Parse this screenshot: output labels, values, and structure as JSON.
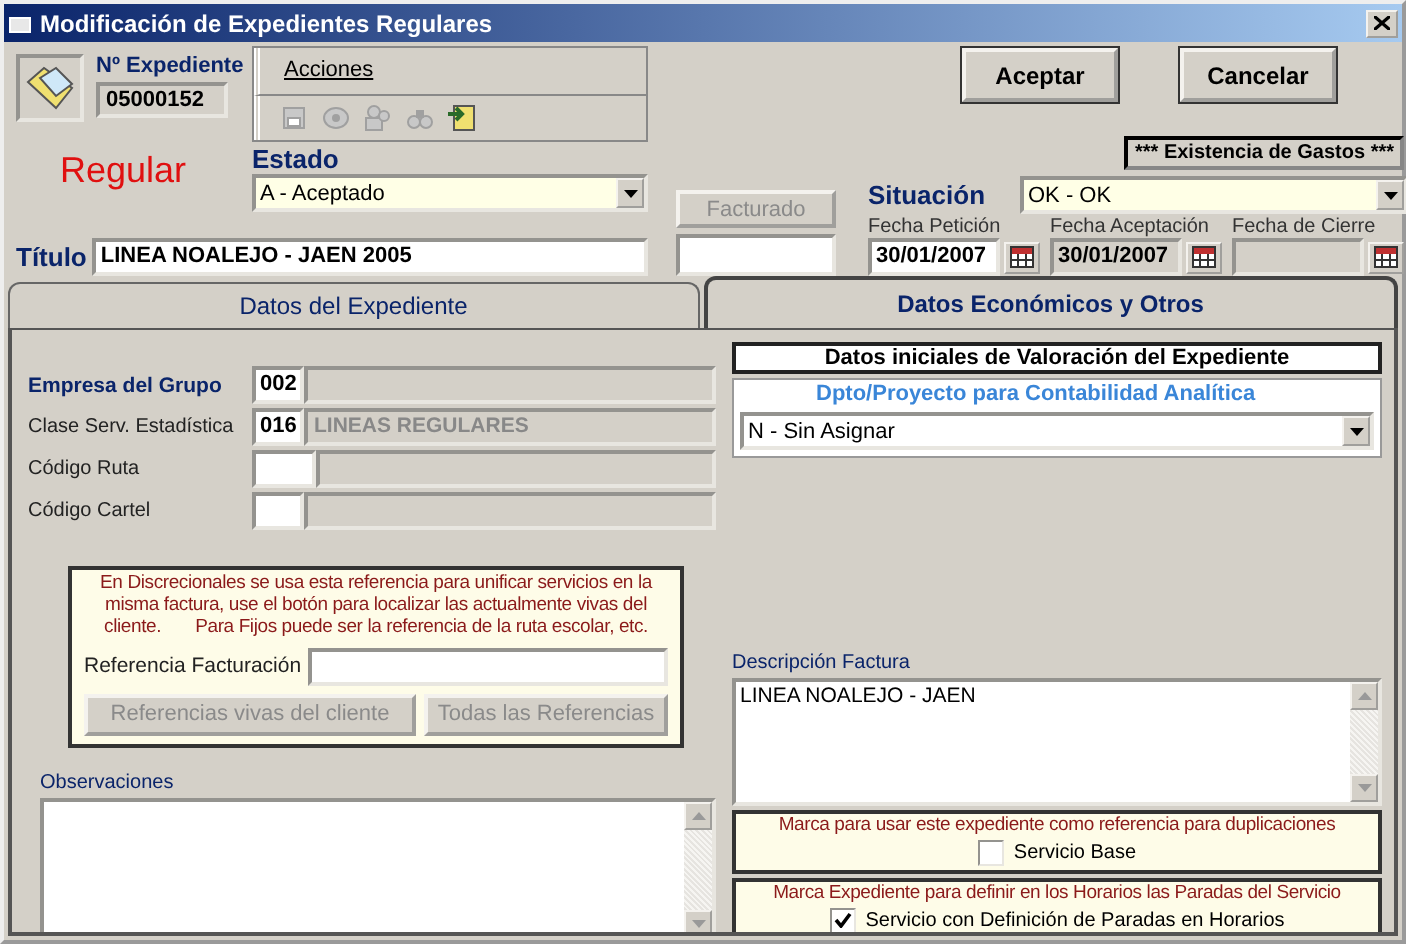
{
  "window": {
    "title": "Modificación de Expedientes Regulares"
  },
  "expediente": {
    "label": "Nº Expediente",
    "value": "05000152"
  },
  "tipo": "Regular",
  "toolbar": {
    "menu": "Acciones",
    "tools": [
      {
        "kind": "save",
        "disabled": true
      },
      {
        "kind": "view",
        "disabled": true
      },
      {
        "kind": "people",
        "disabled": true
      },
      {
        "kind": "find",
        "disabled": true
      },
      {
        "kind": "export",
        "disabled": false
      }
    ]
  },
  "estado": {
    "label": "Estado",
    "value": "A - Aceptado"
  },
  "buttons": [
    {
      "label": "Aceptar"
    },
    {
      "label": "Cancelar"
    }
  ],
  "gastos_badge": "*** Existencia de Gastos ***",
  "facturado": {
    "label": "Facturado",
    "disabled": true
  },
  "situacion": {
    "label": "Situación",
    "value": "OK - OK"
  },
  "fechas": [
    {
      "label": "Fecha Petición",
      "value": "30/01/2007",
      "disabled": false
    },
    {
      "label": "Fecha Aceptación",
      "value": "30/01/2007",
      "disabled": true
    },
    {
      "label": "Fecha de Cierre",
      "disabled": true
    }
  ],
  "titulo": {
    "label": "Título",
    "value": "LINEA NOALEJO - JAEN 2005"
  },
  "tabs": [
    {
      "label": "Datos del Expediente",
      "selected": false
    },
    {
      "label": "Datos Económicos y Otros",
      "selected": true
    }
  ],
  "general": {
    "fields": [
      {
        "label": "Empresa del Grupo",
        "code": "002",
        "emphasis": true
      },
      {
        "label": "Clase Serv. Estadística",
        "code": "016",
        "name": "LINEAS REGULARES",
        "emphasis": false
      },
      {
        "label": "Código Ruta",
        "emphasis": false
      },
      {
        "label": "Código Cartel",
        "emphasis": false
      }
    ]
  },
  "referencia": {
    "note": "En Discrecionales se usa esta referencia para unificar servicios en la misma factura, use el botón para localizar las actualmente vivas del cliente.       Para Fijos puede ser la referencia de la ruta escolar, etc.",
    "label": "Referencia Facturación",
    "buttons": [
      {
        "label": "Referencias vivas del cliente",
        "disabled": true
      },
      {
        "label": "Todas las Referencias",
        "disabled": true
      }
    ]
  },
  "observaciones": {
    "label": "Observaciones"
  },
  "valoracion": {
    "heading": "Datos iniciales de Valoración del Expediente",
    "dpto_label": "Dpto/Proyecto para Contabilidad Analítica",
    "dpto_value": "N - Sin Asignar"
  },
  "descripcion": {
    "label": "Descripción Factura",
    "value": "LINEA NOALEJO - JAEN"
  },
  "marcas": [
    {
      "note": "Marca para usar este expediente como referencia para duplicaciones",
      "label": "Servicio Base",
      "checked": false
    },
    {
      "note": "Marca Expediente para definir en los Horarios las Paradas del Servicio",
      "label": "Servicio con Definición de Paradas en Horarios",
      "checked": true
    }
  ]
}
